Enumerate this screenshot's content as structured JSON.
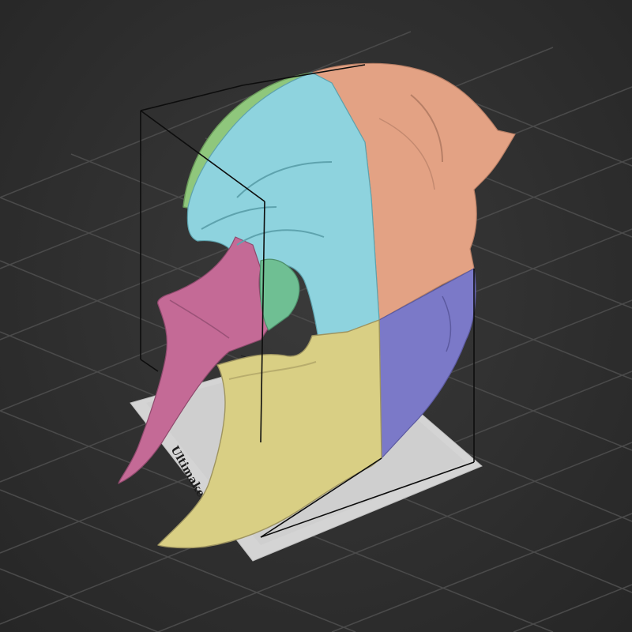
{
  "viewport": {
    "background": "#2e2e2e",
    "grid_color": "#4a4a4a",
    "bounding_box_color": "#111111"
  },
  "build_plate": {
    "label": "Ultimaker Ori",
    "color": "#d9d9d9"
  },
  "model": {
    "description_parts": [
      {
        "name": "top-crest",
        "color": "#8fc77c"
      },
      {
        "name": "front-upper-shell",
        "color": "#8ed3de"
      },
      {
        "name": "rear-upper-shell",
        "color": "#e3a284"
      },
      {
        "name": "left-cheek-guard",
        "color": "#c46a96"
      },
      {
        "name": "inner-cheek",
        "color": "#6fbf93"
      },
      {
        "name": "front-lower-shell",
        "color": "#d9cf84"
      },
      {
        "name": "rear-lower-shell",
        "color": "#7b79c8"
      }
    ]
  }
}
